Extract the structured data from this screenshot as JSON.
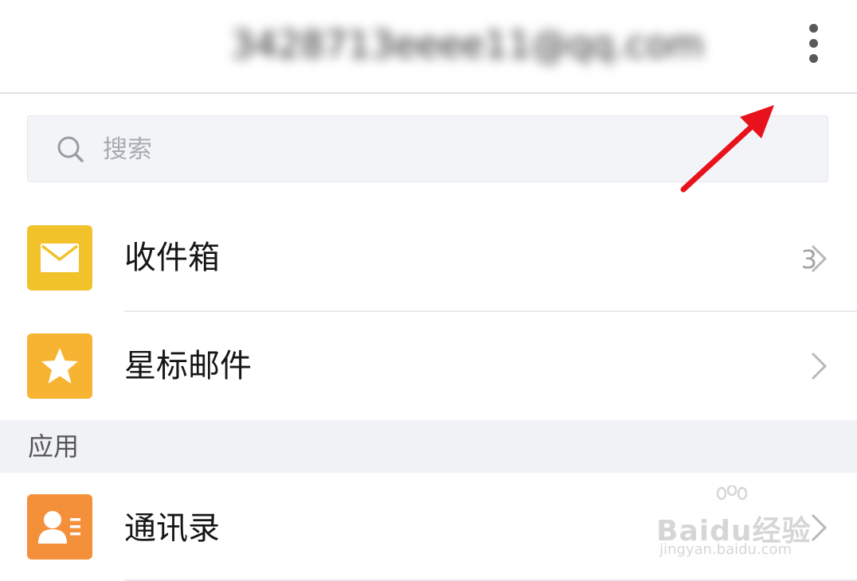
{
  "header": {
    "account_email": "3428713eeee11@qq.com"
  },
  "search": {
    "placeholder": "搜索"
  },
  "mailboxes": [
    {
      "label": "收件箱",
      "count": "3",
      "icon": "envelope-icon",
      "color": "#f1c22a"
    },
    {
      "label": "星标邮件",
      "count": "",
      "icon": "star-icon",
      "color": "#f7b332"
    }
  ],
  "apps_section": {
    "title": "应用",
    "items": [
      {
        "label": "通讯录",
        "icon": "contact-card-icon",
        "color": "#f5903a"
      }
    ]
  },
  "watermark": {
    "brand": "Baidu经验",
    "url": "jingyan.baidu.com"
  },
  "colors": {
    "annotation_arrow": "#e8121c",
    "section_background": "#f1f2f6"
  }
}
